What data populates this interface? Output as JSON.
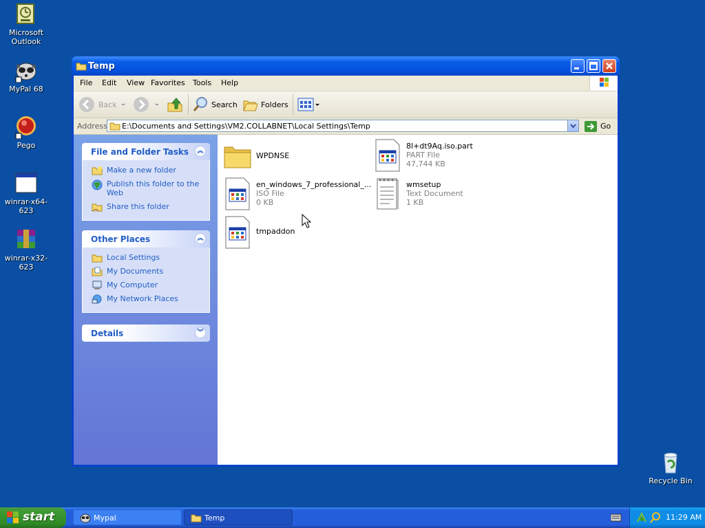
{
  "desktop": {
    "icons": [
      {
        "label": "Microsoft Outlook",
        "icon": "outlook-icon"
      },
      {
        "label": "MyPal 68",
        "icon": "mypal-icon"
      },
      {
        "label": "Pego",
        "icon": "pego-icon"
      },
      {
        "label": "winrar-x64-623",
        "icon": "app-window-icon"
      },
      {
        "label": "winrar-x32-623",
        "icon": "winrar-icon"
      },
      {
        "label": "Recycle Bin",
        "icon": "recycle-bin-icon"
      }
    ]
  },
  "window": {
    "title": "Temp",
    "menu": [
      "File",
      "Edit",
      "View",
      "Favorites",
      "Tools",
      "Help"
    ],
    "toolbar": {
      "back": "Back",
      "search": "Search",
      "folders": "Folders"
    },
    "address": {
      "label": "Address",
      "value": "E:\\Documents and Settings\\VM2.COLLABNET\\Local Settings\\Temp",
      "go": "Go"
    },
    "tasks_panel": {
      "title": "File and Folder Tasks",
      "items": [
        "Make a new folder",
        "Publish this folder to the Web",
        "Share this folder"
      ]
    },
    "places_panel": {
      "title": "Other Places",
      "items": [
        "Local Settings",
        "My Documents",
        "My Computer",
        "My Network Places"
      ]
    },
    "details_panel": {
      "title": "Details"
    },
    "files": [
      {
        "name": "WPDNSE",
        "type": "",
        "size": "",
        "icon": "folder-icon"
      },
      {
        "name": "8l+dt9Aq.iso.part",
        "type": "PART File",
        "size": "47,744 KB",
        "icon": "generic-file-icon"
      },
      {
        "name": "en_windows_7_professional_...",
        "type": "ISO File",
        "size": "0 KB",
        "icon": "generic-file-icon"
      },
      {
        "name": "wmsetup",
        "type": "Text Document",
        "size": "1 KB",
        "icon": "text-document-icon"
      },
      {
        "name": "tmpaddon",
        "type": "",
        "size": "",
        "icon": "generic-file-icon"
      }
    ]
  },
  "taskbar": {
    "start": "start",
    "tasks": [
      {
        "label": "Mypal",
        "active": false
      },
      {
        "label": "Temp",
        "active": true
      }
    ],
    "clock": "11:29 AM"
  },
  "colors": {
    "desktop": "#0a4fa3",
    "titlebar": "#0353e0",
    "link": "#215dc6",
    "start_green": "#3d9a33"
  }
}
